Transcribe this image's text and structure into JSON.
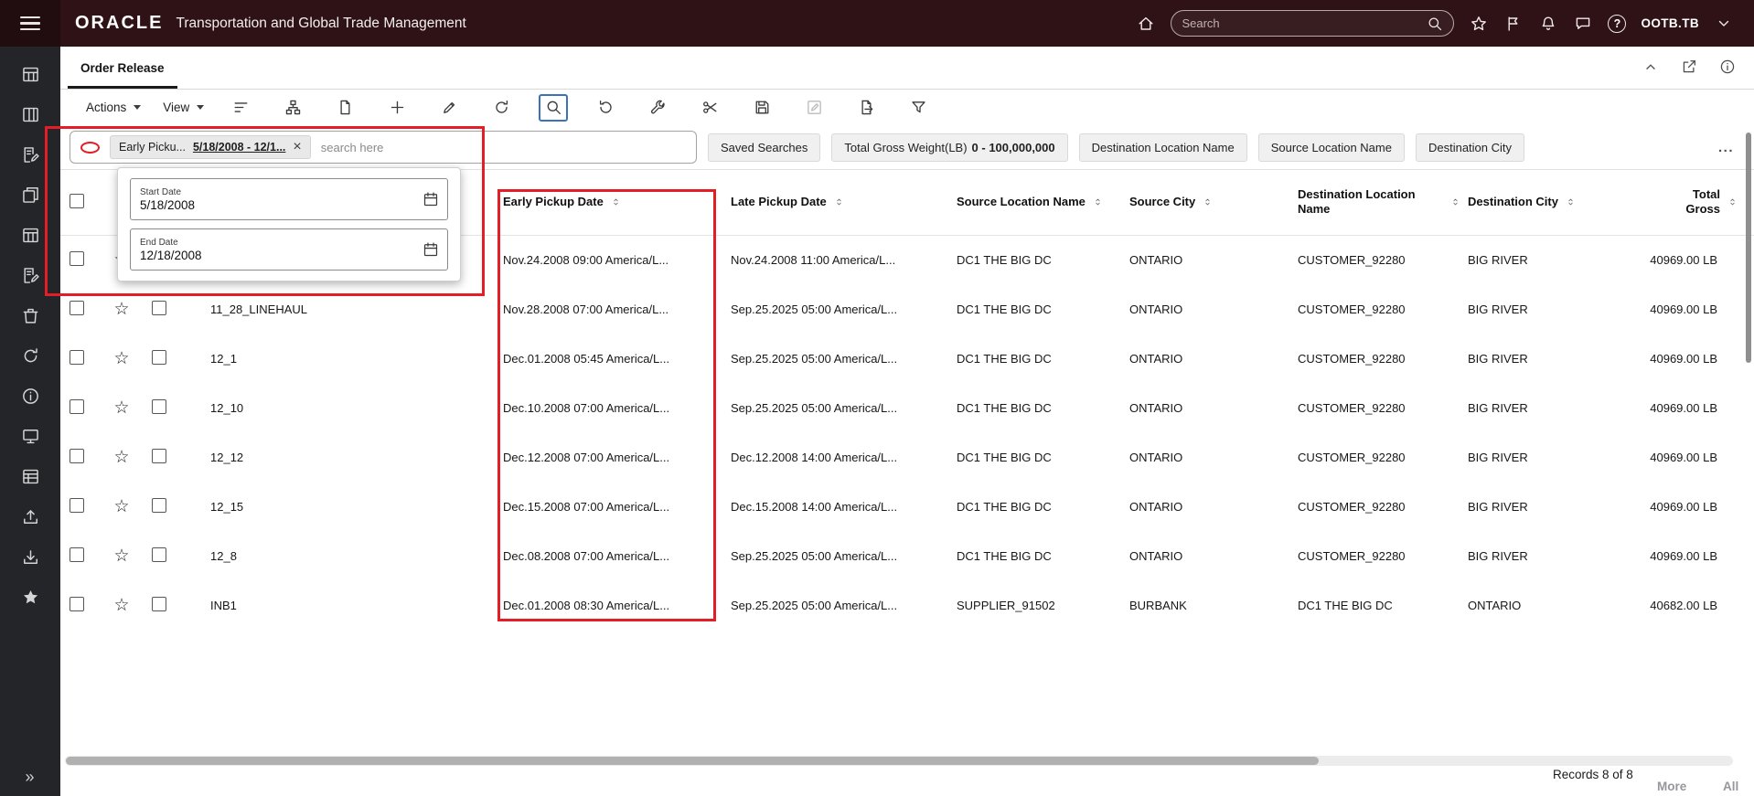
{
  "topbar": {
    "brand": "ORACLE",
    "title": "Transportation and Global Trade Management",
    "search_placeholder": "Search",
    "user_label": "OOTB.TB"
  },
  "page_tab": {
    "title": "Order Release"
  },
  "toolbar": {
    "actions_label": "Actions",
    "view_label": "View",
    "icons": [
      {
        "name": "sort-columns-icon",
        "glyph": "sort"
      },
      {
        "name": "hierarchy-view-icon",
        "glyph": "hierarchy"
      },
      {
        "name": "new-document-icon",
        "glyph": "doc"
      },
      {
        "name": "add-record-icon",
        "glyph": "plus"
      },
      {
        "name": "edit-record-icon",
        "glyph": "pencil"
      },
      {
        "name": "reload-icon",
        "glyph": "reload"
      },
      {
        "name": "search-icon",
        "glyph": "search",
        "active": true
      },
      {
        "name": "refresh-icon",
        "glyph": "refresh"
      },
      {
        "name": "tools-icon",
        "glyph": "wrench"
      },
      {
        "name": "cut-icon",
        "glyph": "scissors"
      },
      {
        "name": "save-icon",
        "glyph": "save"
      },
      {
        "name": "bulk-edit-icon",
        "glyph": "editbox",
        "disabled": true
      },
      {
        "name": "export-icon",
        "glyph": "export"
      },
      {
        "name": "filter-icon",
        "glyph": "funnel"
      }
    ]
  },
  "filterbar": {
    "chip_label": "Early Picku...",
    "chip_value": "5/18/2008 - 12/1...",
    "search_placeholder": "search here",
    "saved_searches_label": "Saved Searches",
    "weight_label": "Total Gross Weight(LB)",
    "weight_value": "0 - 100,000,000",
    "pills": [
      "Destination Location Name",
      "Source Location Name",
      "Destination City"
    ],
    "more_label": "..."
  },
  "date_popup": {
    "start_label": "Start Date",
    "start_value": "5/18/2008",
    "end_label": "End Date",
    "end_value": "12/18/2008"
  },
  "table": {
    "columns": [
      {
        "key": "id",
        "label": "",
        "sortable": false
      },
      {
        "key": "early",
        "label": "Early Pickup Date",
        "sortable": true
      },
      {
        "key": "late",
        "label": "Late Pickup Date",
        "sortable": true
      },
      {
        "key": "src_loc",
        "label": "Source Location Name",
        "sortable": true
      },
      {
        "key": "src_city",
        "label": "Source City",
        "sortable": true
      },
      {
        "key": "dst_loc",
        "label": "Destination Location Name",
        "sortable": true
      },
      {
        "key": "dst_city",
        "label": "Destination City",
        "sortable": true
      },
      {
        "key": "total",
        "label": "Total Gross",
        "sortable": true
      }
    ],
    "rows": [
      {
        "id": "",
        "early": "Nov.24.2008 09:00 America/L...",
        "late": "Nov.24.2008 11:00 America/L...",
        "src_loc": "DC1 THE BIG DC",
        "src_city": "ONTARIO",
        "dst_loc": "CUSTOMER_92280",
        "dst_city": "BIG RIVER",
        "total": "40969.00 LB"
      },
      {
        "id": "11_28_LINEHAUL",
        "early": "Nov.28.2008 07:00 America/L...",
        "late": "Sep.25.2025 05:00 America/L...",
        "src_loc": "DC1 THE BIG DC",
        "src_city": "ONTARIO",
        "dst_loc": "CUSTOMER_92280",
        "dst_city": "BIG RIVER",
        "total": "40969.00 LB"
      },
      {
        "id": "12_1",
        "early": "Dec.01.2008 05:45 America/L...",
        "late": "Sep.25.2025 05:00 America/L...",
        "src_loc": "DC1 THE BIG DC",
        "src_city": "ONTARIO",
        "dst_loc": "CUSTOMER_92280",
        "dst_city": "BIG RIVER",
        "total": "40969.00 LB"
      },
      {
        "id": "12_10",
        "early": "Dec.10.2008 07:00 America/L...",
        "late": "Sep.25.2025 05:00 America/L...",
        "src_loc": "DC1 THE BIG DC",
        "src_city": "ONTARIO",
        "dst_loc": "CUSTOMER_92280",
        "dst_city": "BIG RIVER",
        "total": "40969.00 LB"
      },
      {
        "id": "12_12",
        "early": "Dec.12.2008 07:00 America/L...",
        "late": "Dec.12.2008 14:00 America/L...",
        "src_loc": "DC1 THE BIG DC",
        "src_city": "ONTARIO",
        "dst_loc": "CUSTOMER_92280",
        "dst_city": "BIG RIVER",
        "total": "40969.00 LB"
      },
      {
        "id": "12_15",
        "early": "Dec.15.2008 07:00 America/L...",
        "late": "Dec.15.2008 14:00 America/L...",
        "src_loc": "DC1 THE BIG DC",
        "src_city": "ONTARIO",
        "dst_loc": "CUSTOMER_92280",
        "dst_city": "BIG RIVER",
        "total": "40969.00 LB"
      },
      {
        "id": "12_8",
        "early": "Dec.08.2008 07:00 America/L...",
        "late": "Sep.25.2025 05:00 America/L...",
        "src_loc": "DC1 THE BIG DC",
        "src_city": "ONTARIO",
        "dst_loc": "CUSTOMER_92280",
        "dst_city": "BIG RIVER",
        "total": "40969.00 LB"
      },
      {
        "id": "INB1",
        "early": "Dec.01.2008 08:30 America/L...",
        "late": "Sep.25.2025 05:00 America/L...",
        "src_loc": "SUPPLIER_91502",
        "src_city": "BURBANK",
        "dst_loc": "DC1 THE BIG DC",
        "dst_city": "ONTARIO",
        "total": "40682.00 LB"
      }
    ]
  },
  "sidebar": {
    "icons": [
      {
        "name": "workbench-grid-icon",
        "glyph": "grid"
      },
      {
        "name": "layout-columns-icon",
        "glyph": "columns"
      },
      {
        "name": "edit-document-icon",
        "glyph": "doc-edit"
      },
      {
        "name": "copy-pages-icon",
        "glyph": "copy"
      },
      {
        "name": "table-view-icon",
        "glyph": "table"
      },
      {
        "name": "compose-document-icon",
        "glyph": "doc-edit"
      },
      {
        "name": "delete-icon",
        "glyph": "trash"
      },
      {
        "name": "refresh-icon",
        "glyph": "reload"
      },
      {
        "name": "info-icon",
        "glyph": "info"
      },
      {
        "name": "monitor-icon",
        "glyph": "monitor"
      },
      {
        "name": "data-grid-icon",
        "glyph": "table2"
      },
      {
        "name": "upload-icon",
        "glyph": "upload"
      },
      {
        "name": "download-icon",
        "glyph": "download"
      },
      {
        "name": "favorites-icon",
        "glyph": "star-fill"
      }
    ],
    "expand_label": "»"
  },
  "footer": {
    "records_label": "Records 8 of 8",
    "more_label": "More",
    "all_label": "All"
  },
  "colors": {
    "accent_red": "#e41e26",
    "topbar_bg": "#2e1216",
    "sidebar_bg": "#242529",
    "highlight_blue": "#3c72b8"
  }
}
